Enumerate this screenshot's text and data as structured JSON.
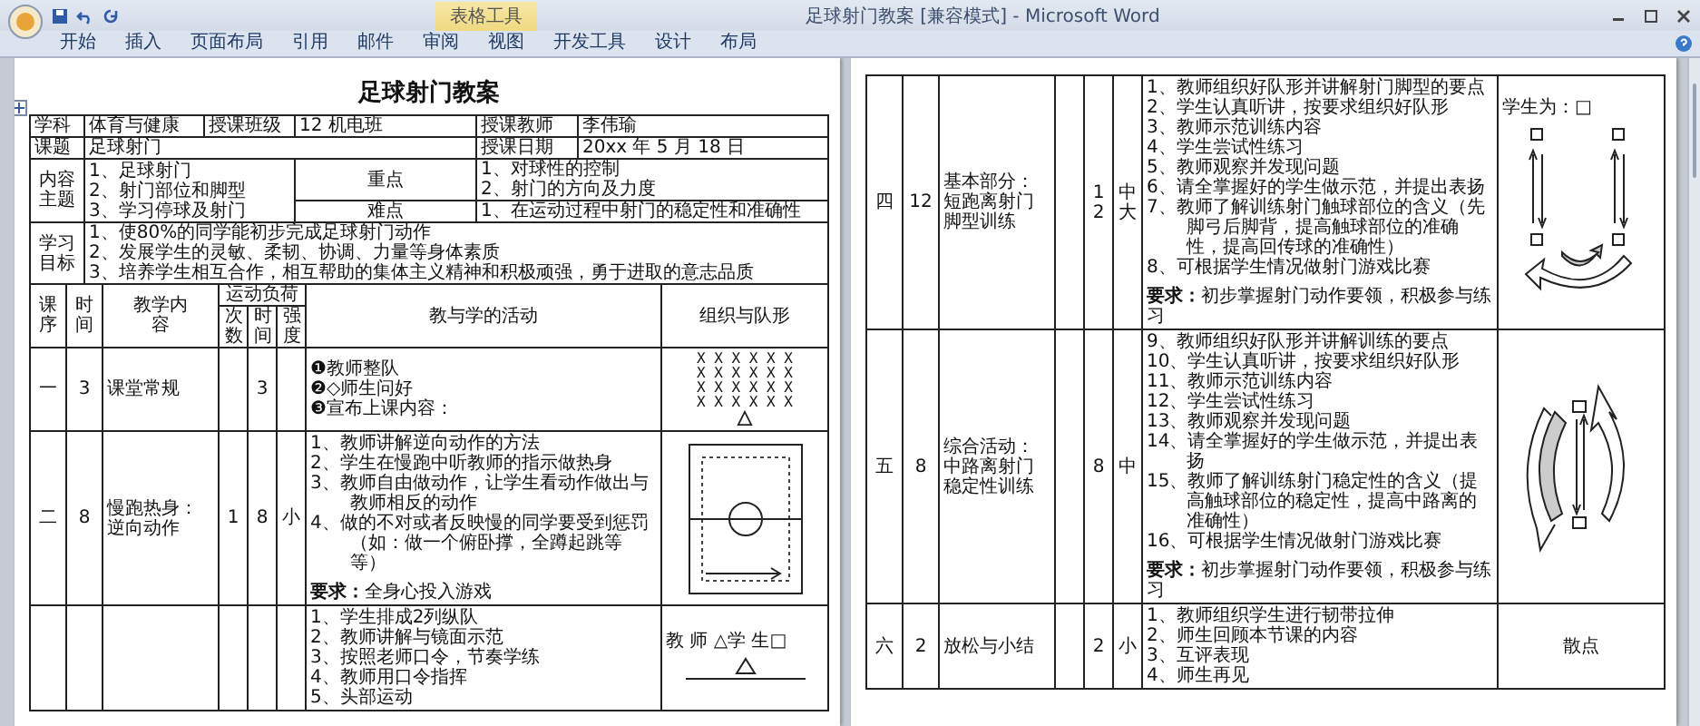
{
  "window": {
    "title": "足球射门教案 [兼容模式] - Microsoft Word",
    "context_tab": "表格工具"
  },
  "tabs": [
    {
      "label": "开始",
      "selected": false
    },
    {
      "label": "插入",
      "selected": false
    },
    {
      "label": "页面布局",
      "selected": false
    },
    {
      "label": "引用",
      "selected": false
    },
    {
      "label": "邮件",
      "selected": false
    },
    {
      "label": "审阅",
      "selected": false
    },
    {
      "label": "视图",
      "selected": false
    },
    {
      "label": "开发工具",
      "selected": false
    },
    {
      "label": "设计",
      "selected": false
    },
    {
      "label": "布局",
      "selected": false
    }
  ],
  "document": {
    "title": "足球射门教案",
    "info": {
      "subject_label": "学科",
      "subject": "体育与健康",
      "class_label": "授课班级",
      "class": "12 机电班",
      "teacher_label": "授课教师",
      "teacher": "李伟瑜",
      "topic_label": "课题",
      "topic": "足球射门",
      "date_label": "授课日期",
      "date": "20xx 年 5 月 18 日",
      "content_label": "内容主题",
      "content": [
        "1、足球射门",
        "2、射门部位和脚型",
        "3、学习停球及射门"
      ],
      "key_label": "重点",
      "key": [
        "1、对球性的控制",
        "2、射门的方向及力度"
      ],
      "difficulty_label": "难点",
      "difficulty": [
        "1、在运动过程中射门的稳定性和准确性"
      ],
      "goals_label": "学习目标",
      "goals": [
        "1、使80%的同学能初步完成足球射门动作",
        "2、发展学生的灵敏、柔韧、协调、力量等身体素质",
        "3、培养学生相互合作，相互帮助的集体主义精神和积极顽强，勇于进取的意志品质"
      ]
    },
    "columns": {
      "seq": "课序",
      "time": "时间",
      "content": "教学内容",
      "load": "运动负荷",
      "count": "次数",
      "duration": "时间",
      "intensity": "强度",
      "activity": "教与学的活动",
      "organization": "组织与队形"
    },
    "pages": [
      {
        "rows": [
          {
            "seq": "一",
            "time": "3",
            "content": "课堂常规",
            "duration": "3",
            "activities": [
              "❶教师整队",
              "❷◇师生问好",
              "❸宣布上课内容："
            ],
            "organization": {
              "kind": "formation",
              "lines": [
                "X X X X X X",
                "X X X X X X",
                "X X X X X X",
                "X X X X X X"
              ]
            }
          },
          {
            "seq": "二",
            "time": "8",
            "content": "慢跑热身：逆向动作",
            "count": "1",
            "duration": "8",
            "intensity": "小",
            "activities": [
              "1、教师讲解逆向动作的方法",
              "2、学生在慢跑中听教师的指示做热身",
              "3、教师自由做动作，让学生看动作做出与教师相反的动作",
              "4、做的不对或者反映慢的同学要受到惩罚（如：做一个俯卧撑，全蹲起跳等等）"
            ],
            "requirement": "**要求：**全身心投入游戏",
            "organization": {
              "kind": "field"
            }
          },
          {
            "activities": [
              "1、学生排成2列纵队",
              "2、教师讲解与镜面示范",
              "3、按照老师口令，节奏学练",
              "4、教师用口令指挥",
              "5、头部运动"
            ],
            "organization": {
              "kind": "legend",
              "text": "教 师 △学 生□"
            }
          }
        ]
      },
      {
        "rows": [
          {
            "seq": "四",
            "time": "12",
            "content": "基本部分：短跑离射门脚型训练",
            "duration": "12",
            "intensity": "中大",
            "activities": [
              "1、教师组织好队形并讲解射门脚型的要点",
              "2、学生认真听讲，按要求组织好队形",
              "3、教师示范训练内容",
              "4、学生尝试性练习",
              "5、教师观察并发现问题",
              "6、请全掌握好的学生做示范，并提出表扬",
              "7、教师了解训练射门触球部位的含义（先脚弓后脚背，提高触球部位的准确性，提高回传球的准确性）",
              "8、可根据学生情况做射门游戏比赛"
            ],
            "requirement": "**要求：**初步掌握射门动作要领，积极参与练习",
            "organization": {
              "kind": "drill",
              "text": "学生为：□"
            }
          },
          {
            "seq": "五",
            "time": "8",
            "content": "综合活动：中路离射门稳定性训练",
            "duration": "8",
            "intensity": "中",
            "activities": [
              "9、教师组织好队形并讲解训练的要点",
              "10、学生认真听讲，按要求组织好队形",
              "11、教师示范训练内容",
              "12、学生尝试性练习",
              "13、教师观察并发现问题",
              "14、请全掌握好的学生做示范，并提出表扬",
              "15、教师了解训练射门稳定性的含义（提高触球部位的稳定性，提高中路离的准确性）",
              "16、可根据学生情况做射门游戏比赛"
            ],
            "requirement": "**要求：**初步掌握射门动作要领，积极参与练习",
            "organization": {
              "kind": "circuit"
            }
          },
          {
            "seq": "六",
            "time": "2",
            "content": "放松与小结",
            "duration": "2",
            "intensity": "小",
            "activities": [
              "1、教师组织学生进行韧带拉伸",
              "2、师生回顾本节课的内容",
              "3、互评表现",
              "4、师生再见"
            ],
            "organization": {
              "kind": "text",
              "text": "散点"
            }
          }
        ]
      }
    ]
  }
}
